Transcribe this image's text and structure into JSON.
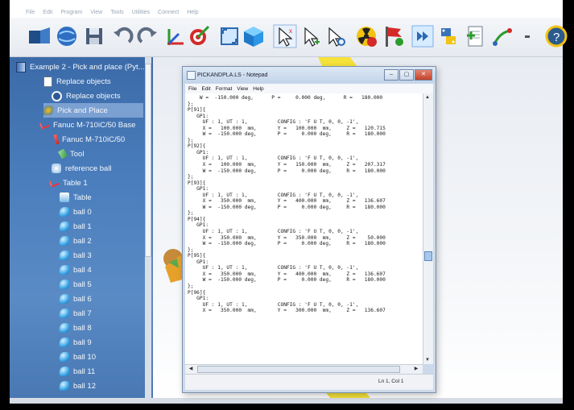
{
  "app": {
    "menu": [
      "File",
      "Edit",
      "Program",
      "View",
      "Tools",
      "Utilities",
      "Connect",
      "Help"
    ]
  },
  "toolbar": {
    "buttons": [
      "station-icon",
      "globe-icon",
      "save-icon",
      "undo-icon",
      "redo-icon",
      "add-frame-icon",
      "target-icon",
      "fit-view-icon",
      "cube-icon",
      "select-icon",
      "move-icon",
      "rotate-icon",
      "radiation-icon",
      "flag-icon",
      "forward-icon",
      "python-icon",
      "add-program-icon",
      "path-icon",
      "drop-icon",
      "help-icon"
    ]
  },
  "tree": {
    "items": [
      {
        "label": "Example 2 - Pick and place (Pyt...",
        "icon": "book-icon",
        "indent": 0,
        "selected": false
      },
      {
        "label": "Replace objects",
        "icon": "doc-icon",
        "indent": 1,
        "selected": false
      },
      {
        "label": "Replace objects",
        "icon": "run-icon",
        "indent": 2,
        "selected": false
      },
      {
        "label": "Pick and Place",
        "icon": "python-icon",
        "indent": 1,
        "selected": true
      },
      {
        "label": "Fanuc M-710iC/50 Base",
        "icon": "frame-icon",
        "indent": 1,
        "selected": false
      },
      {
        "label": "Fanuc M-710iC/50",
        "icon": "robot-icon",
        "indent": 2,
        "selected": false
      },
      {
        "label": "Tool",
        "icon": "tool-icon",
        "indent": 3,
        "selected": false
      },
      {
        "label": "reference ball",
        "icon": "reference-icon",
        "indent": 2,
        "selected": false
      },
      {
        "label": "Table 1",
        "icon": "frame-icon",
        "indent": 2,
        "selected": false
      },
      {
        "label": "Table",
        "icon": "table-icon",
        "indent": 3,
        "selected": false
      },
      {
        "label": "ball 0",
        "icon": "ball-icon",
        "indent": 3,
        "selected": false
      },
      {
        "label": "ball 1",
        "icon": "ball-icon",
        "indent": 3,
        "selected": false
      },
      {
        "label": "ball 2",
        "icon": "ball-icon",
        "indent": 3,
        "selected": false
      },
      {
        "label": "ball 3",
        "icon": "ball-icon",
        "indent": 3,
        "selected": false
      },
      {
        "label": "ball 4",
        "icon": "ball-icon",
        "indent": 3,
        "selected": false
      },
      {
        "label": "ball 5",
        "icon": "ball-icon",
        "indent": 3,
        "selected": false
      },
      {
        "label": "ball 6",
        "icon": "ball-icon",
        "indent": 3,
        "selected": false
      },
      {
        "label": "ball 7",
        "icon": "ball-icon",
        "indent": 3,
        "selected": false
      },
      {
        "label": "ball 8",
        "icon": "ball-icon",
        "indent": 3,
        "selected": false
      },
      {
        "label": "ball 9",
        "icon": "ball-icon",
        "indent": 3,
        "selected": false
      },
      {
        "label": "ball 10",
        "icon": "ball-icon",
        "indent": 3,
        "selected": false
      },
      {
        "label": "ball 11",
        "icon": "ball-icon",
        "indent": 3,
        "selected": false
      },
      {
        "label": "ball 12",
        "icon": "ball-icon",
        "indent": 3,
        "selected": false
      }
    ]
  },
  "notepad": {
    "title": "PICKANDPLA.LS - Notepad",
    "menu": [
      "File",
      "Edit",
      "Format",
      "View",
      "Help"
    ],
    "minimize_label": "–",
    "maximize_label": "▢",
    "close_label": "✕",
    "content": "    W =  -150.000 deg,      P =     0.000 deg,      R =   180.000\n};\nP[91]{\n   GP1:\n     UF : 1, UT : 1,          CONFIG : 'F U T, 0, 0, -1',\n     X =   100.000  mm,       Y =   100.000  mm,     Z =   120.715\n     W =  -150.000 deg,       P =     0.000 deg,     R =   180.000\n};\nP[92]{\n   GP1:\n     UF : 1, UT : 1,          CONFIG : 'F U T, 0, 0, -1',\n     X =   100.000  mm,       Y =   150.000  mm,     Z =   207.317\n     W =  -150.000 deg,       P =     0.000 deg,     R =   180.000\n};\nP[93]{\n   GP1:\n     UF : 1, UT : 1,          CONFIG : 'F U T, 0, 0, -1',\n     X =   350.000  mm,       Y =   400.000  mm,     Z =   136.607\n     W =  -150.000 deg,       P =     0.000 deg,     R =   180.000\n};\nP[94]{\n   GP1:\n     UF : 1, UT : 1,          CONFIG : 'F U T, 0, 0, -1',\n     X =   350.000  mm,       Y =   350.000  mm,     Z =    50.000\n     W =  -150.000 deg,       P =     0.000 deg,     R =   180.000\n};\nP[95]{\n   GP1:\n     UF : 1, UT : 1,          CONFIG : 'F U T, 0, 0, -1',\n     X =   350.000  mm,       Y =   400.000  mm,     Z =   136.607\n     W =  -150.000 deg,       P =     0.000 deg,     R =   180.000\n};\nP[96]{\n   GP1:\n     UF : 1, UT : 1,          CONFIG : 'F U T, 0, 0, -1',\n     X =   350.000  mm,       Y =   300.000  mm,     Z =   136.607",
    "status": "Ln 1, Col 1"
  }
}
